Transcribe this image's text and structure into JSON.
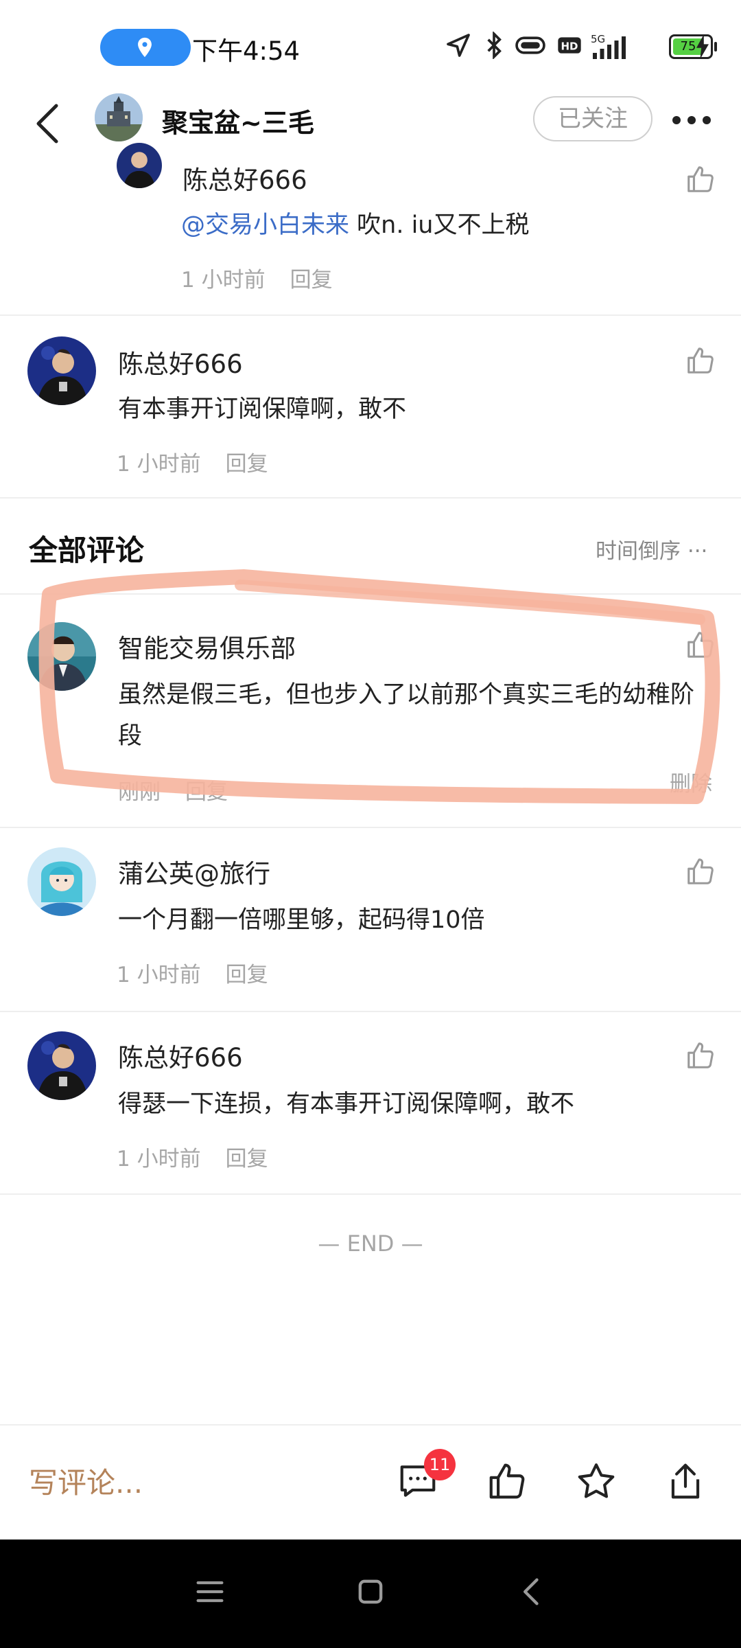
{
  "status_bar": {
    "time": "下午4:54",
    "battery": "75",
    "network": "5G"
  },
  "header": {
    "title": "聚宝盆~三毛",
    "follow_label": "已关注"
  },
  "reply_thread": [
    {
      "username": "陈总好666",
      "mention": "@交易小白未来",
      "text": " 吹n. iu又不上税",
      "time": "1 小时前",
      "reply_label": "回复"
    },
    {
      "username": "陈总好666",
      "text": "有本事开订阅保障啊，敢不",
      "time": "1 小时前",
      "reply_label": "回复"
    }
  ],
  "all_comments": {
    "title": "全部评论",
    "sort_label": "时间倒序 ···",
    "items": [
      {
        "username": "智能交易俱乐部",
        "text": "虽然是假三毛，但也步入了以前那个真实三毛的幼稚阶段",
        "time": "刚刚",
        "reply_label": "回复",
        "delete_label": "删除"
      },
      {
        "username": "蒲公英@旅行",
        "text": "一个月翻一倍哪里够，起码得10倍",
        "time": "1 小时前",
        "reply_label": "回复"
      },
      {
        "username": "陈总好666",
        "text": "得瑟一下连损，有本事开订阅保障啊，敢不",
        "time": "1 小时前",
        "reply_label": "回复"
      }
    ]
  },
  "end_label": "— END —",
  "bottom_bar": {
    "write_placeholder": "写评论...",
    "comment_count": "11"
  },
  "colors": {
    "accent_link": "#3b6cc7",
    "write_comment": "#b4835a",
    "badge": "#f5333f",
    "annotation_stroke": "#f6b49d"
  }
}
